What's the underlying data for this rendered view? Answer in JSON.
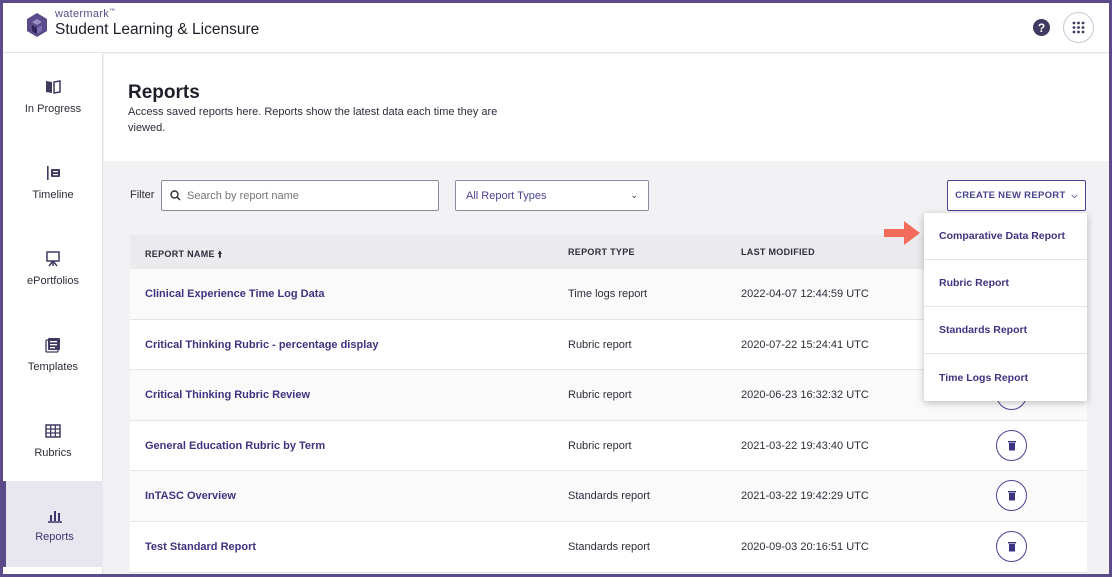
{
  "header": {
    "brand": "watermark",
    "brand_tm": "™",
    "product": "Student Learning & Licensure",
    "help_icon": "help-icon",
    "apps_icon": "apps-grid-icon",
    "accent": "#5b4b8a"
  },
  "sidebar": {
    "items": [
      {
        "label": "In Progress",
        "icon": "book-icon"
      },
      {
        "label": "Timeline",
        "icon": "timeline-icon"
      },
      {
        "label": "ePortfolios",
        "icon": "easel-icon"
      },
      {
        "label": "Templates",
        "icon": "templates-icon"
      },
      {
        "label": "Rubrics",
        "icon": "grid-icon"
      },
      {
        "label": "Reports",
        "icon": "bar-chart-icon",
        "active": true
      }
    ]
  },
  "main": {
    "title": "Reports",
    "description": "Access saved reports here. Reports show the latest data each time they are viewed.",
    "filter_label": "Filter",
    "search_placeholder": "Search by report name",
    "type_select": "All Report Types",
    "create_button": "CREATE NEW REPORT"
  },
  "table": {
    "headers": {
      "name": "REPORT NAME",
      "type": "REPORT TYPE",
      "modified": "LAST MODIFIED"
    },
    "rows": [
      {
        "name": "Clinical Experience Time Log Data",
        "type": "Time logs report",
        "modified": "2022-04-07 12:44:59 UTC"
      },
      {
        "name": "Critical Thinking Rubric - percentage display",
        "type": "Rubric report",
        "modified": "2020-07-22 15:24:41 UTC"
      },
      {
        "name": "Critical Thinking Rubric Review",
        "type": "Rubric report",
        "modified": "2020-06-23 16:32:32 UTC"
      },
      {
        "name": "General Education Rubric by Term",
        "type": "Rubric report",
        "modified": "2021-03-22 19:43:40 UTC"
      },
      {
        "name": "InTASC Overview",
        "type": "Standards report",
        "modified": "2021-03-22 19:42:29 UTC"
      },
      {
        "name": "Test Standard Report",
        "type": "Standards report",
        "modified": "2020-09-03 20:16:51 UTC"
      }
    ]
  },
  "create_menu": {
    "items": [
      "Comparative Data Report",
      "Rubric Report",
      "Standards Report",
      "Time Logs Report"
    ]
  }
}
